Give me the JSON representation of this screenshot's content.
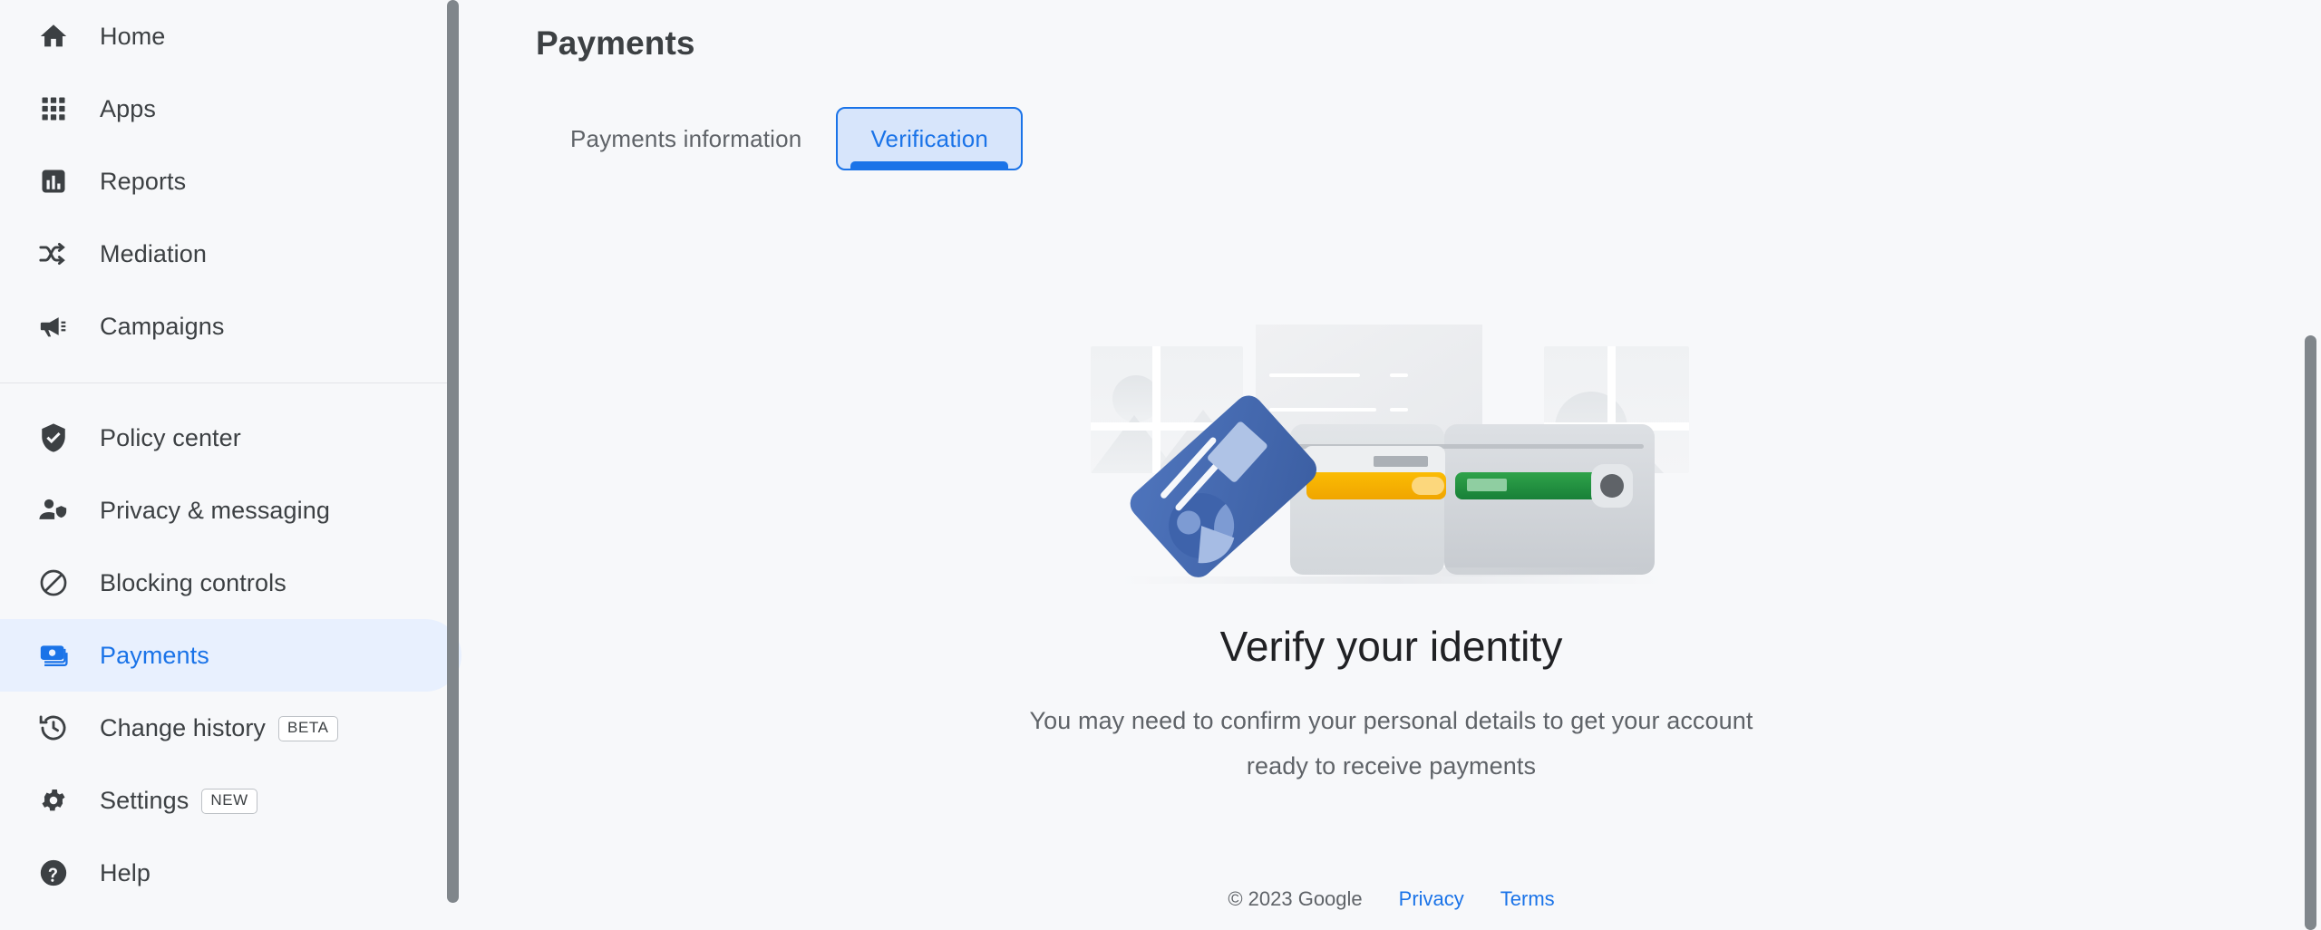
{
  "sidebar": {
    "scrollbar": {
      "name": "sidebar-scrollbar"
    },
    "group_primary": [
      {
        "id": "home",
        "label": "Home",
        "icon": "home-icon",
        "selected": false,
        "chip": ""
      },
      {
        "id": "apps",
        "label": "Apps",
        "icon": "apps-grid-icon",
        "selected": false,
        "chip": ""
      },
      {
        "id": "reports",
        "label": "Reports",
        "icon": "bar-chart-icon",
        "selected": false,
        "chip": ""
      },
      {
        "id": "mediation",
        "label": "Mediation",
        "icon": "mediation-arrows-icon",
        "selected": false,
        "chip": ""
      },
      {
        "id": "campaigns",
        "label": "Campaigns",
        "icon": "megaphone-icon",
        "selected": false,
        "chip": ""
      }
    ],
    "group_secondary": [
      {
        "id": "policy-center",
        "label": "Policy center",
        "icon": "shield-check-icon",
        "selected": false,
        "chip": ""
      },
      {
        "id": "privacy-messaging",
        "label": "Privacy & messaging",
        "icon": "person-shield-icon",
        "selected": false,
        "chip": ""
      },
      {
        "id": "blocking-controls",
        "label": "Blocking controls",
        "icon": "block-circle-icon",
        "selected": false,
        "chip": ""
      },
      {
        "id": "payments",
        "label": "Payments",
        "icon": "money-bills-icon",
        "selected": true,
        "chip": ""
      },
      {
        "id": "change-history",
        "label": "Change history",
        "icon": "history-clock-icon",
        "selected": false,
        "chip": "BETA"
      },
      {
        "id": "settings",
        "label": "Settings",
        "icon": "gear-icon",
        "selected": false,
        "chip": "NEW"
      },
      {
        "id": "help",
        "label": "Help",
        "icon": "help-circle-icon",
        "selected": false,
        "chip": ""
      }
    ]
  },
  "header": {
    "title": "Payments"
  },
  "tabs": [
    {
      "id": "payments-information",
      "label": "Payments information",
      "active": false
    },
    {
      "id": "verification",
      "label": "Verification",
      "active": true
    }
  ],
  "empty_state": {
    "illustration_name": "verify-identity-wallet-illustration",
    "heading": "Verify your identity",
    "body": "You may need to confirm your personal details to get your account ready to receive payments"
  },
  "footer": {
    "copyright": "© 2023 Google",
    "links": [
      {
        "id": "privacy",
        "label": "Privacy"
      },
      {
        "id": "terms",
        "label": "Terms"
      }
    ]
  },
  "colors": {
    "page_bg": "#F7F8FA",
    "accent_blue": "#1A73E8",
    "selected_pill_bg": "#E8F0FE",
    "tab_focus_bg": "#D7E5FB",
    "text_primary": "#202124",
    "text_secondary": "#5F6368",
    "divider": "#E3E4E8",
    "scrollbar": "#80868B",
    "illus_card_blue": "#4A6FB5",
    "illus_card_yellow": "#F9AB00",
    "illus_card_green": "#1E8E3E"
  }
}
